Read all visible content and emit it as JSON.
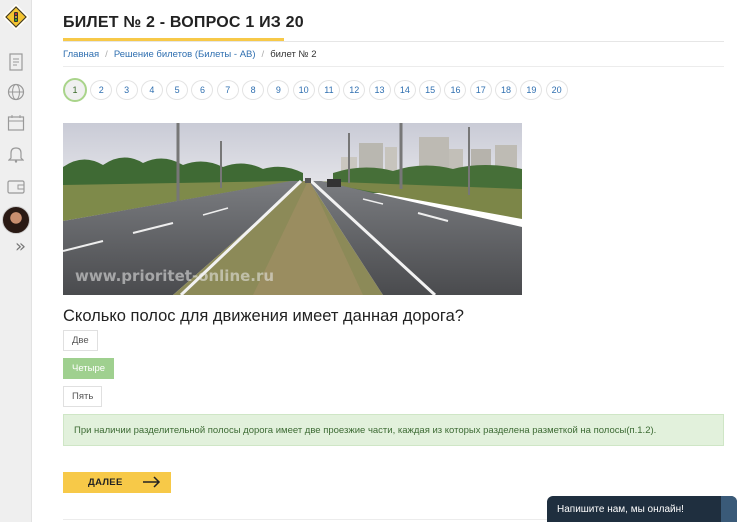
{
  "page": {
    "title": "БИЛЕТ № 2 - ВОПРОС 1 ИЗ 20"
  },
  "breadcrumbs": {
    "home": "Главная",
    "section": "Решение билетов (Билеты - AB)",
    "current": "билет № 2"
  },
  "question_numbers": [
    "1",
    "2",
    "3",
    "4",
    "5",
    "6",
    "7",
    "8",
    "9",
    "10",
    "11",
    "12",
    "13",
    "14",
    "15",
    "16",
    "17",
    "18",
    "19",
    "20"
  ],
  "active_question": "1",
  "image": {
    "watermark": "www.prioritet-online.ru"
  },
  "question": {
    "text": "Сколько полос для движения имеет данная дорога?",
    "answers": [
      "Две",
      "Четыре",
      "Пять"
    ],
    "correct_answer": "Четыре"
  },
  "explanation": "При наличии разделительной полосы дорога имеет две проезжие части, каждая из которых разделена разметкой на полосы(п.1.2).",
  "next_button": "ДАЛЕЕ",
  "chat_widget": "Напишите нам, мы онлайн!",
  "colors": {
    "accent_yellow": "#f7c948",
    "correct_green": "#9fd08f",
    "link_blue": "#2f6fb0",
    "chat_dark": "#1f2f3f"
  },
  "icons": {
    "logo": "road-sign-logo-icon",
    "sidebar": [
      "document-icon",
      "globe-icon",
      "calendar-icon",
      "bell-icon",
      "wallet-icon"
    ],
    "expand": "double-chevron-right-icon"
  }
}
